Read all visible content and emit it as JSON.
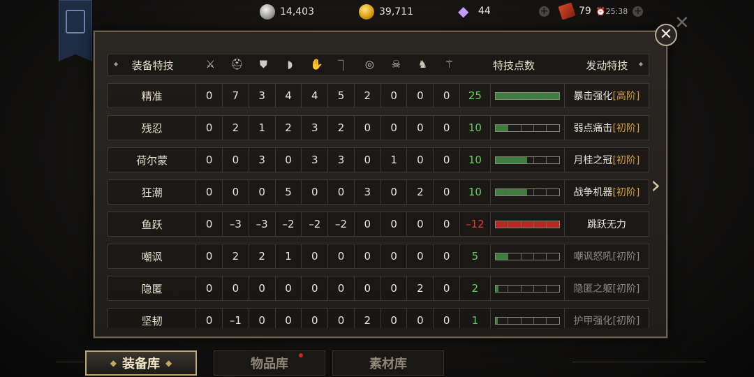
{
  "resources": {
    "silver": "14,403",
    "gold": "39,711",
    "gems": "44",
    "tickets": "79",
    "timer": "25:38"
  },
  "icons": {
    "silver": "silver-coin-icon",
    "gold": "gold-coin-icon",
    "gem": "diamond-icon",
    "ticket": "ticket-icon"
  },
  "header": {
    "equip_skill": "装备特技",
    "points": "特技点数",
    "active_skill": "发动特技",
    "slot_icons": [
      "sword-icon",
      "helmet-icon",
      "chest-armor-icon",
      "shoulder-icon",
      "gauntlet-icon",
      "boot-icon",
      "ring-icon",
      "demon-mask-icon",
      "horse-icon",
      "scythe-icon"
    ]
  },
  "rows": [
    {
      "name": "精准",
      "values": [
        "0",
        "7",
        "3",
        "4",
        "4",
        "5",
        "2",
        "0",
        "0",
        "0"
      ],
      "points": "25",
      "level": 1.0,
      "sign": "pos",
      "skill": "暴击强化",
      "tier": "[高阶]",
      "active": true
    },
    {
      "name": "残忍",
      "values": [
        "0",
        "2",
        "1",
        "2",
        "3",
        "2",
        "0",
        "0",
        "0",
        "0"
      ],
      "points": "10",
      "level": 0.2,
      "sign": "pos",
      "skill": "弱点痛击",
      "tier": "[初阶]",
      "active": true
    },
    {
      "name": "荷尔蒙",
      "values": [
        "0",
        "0",
        "3",
        "0",
        "3",
        "3",
        "0",
        "1",
        "0",
        "0"
      ],
      "points": "10",
      "level": 0.5,
      "sign": "pos",
      "skill": "月桂之冠",
      "tier": "[初阶]",
      "active": true
    },
    {
      "name": "狂潮",
      "values": [
        "0",
        "0",
        "0",
        "5",
        "0",
        "0",
        "3",
        "0",
        "2",
        "0"
      ],
      "points": "10",
      "level": 0.5,
      "sign": "pos",
      "skill": "战争机器",
      "tier": "[初阶]",
      "active": true
    },
    {
      "name": "鱼跃",
      "values": [
        "0",
        "–3",
        "–3",
        "–2",
        "–2",
        "–2",
        "0",
        "0",
        "0",
        "0"
      ],
      "points": "–12",
      "level": 1.0,
      "sign": "neg",
      "skill": "跳跃无力",
      "tier": "",
      "active": true
    },
    {
      "name": "嘲讽",
      "values": [
        "0",
        "2",
        "2",
        "1",
        "0",
        "0",
        "0",
        "0",
        "0",
        "0"
      ],
      "points": "5",
      "level": 0.2,
      "sign": "pos",
      "skill": "嘲讽怒吼",
      "tier": "[初阶]",
      "active": false
    },
    {
      "name": "隐匿",
      "values": [
        "0",
        "0",
        "0",
        "0",
        "0",
        "0",
        "0",
        "0",
        "2",
        "0"
      ],
      "points": "2",
      "level": 0.05,
      "sign": "pos",
      "skill": "隐匿之躯",
      "tier": "[初阶]",
      "active": false
    },
    {
      "name": "坚韧",
      "values": [
        "0",
        "–1",
        "0",
        "0",
        "0",
        "0",
        "2",
        "0",
        "0",
        "0"
      ],
      "points": "1",
      "level": 0.03,
      "sign": "pos",
      "skill": "护甲强化",
      "tier": "[初阶]",
      "active": false
    }
  ],
  "tabs": [
    {
      "label": "装备库",
      "active": true
    },
    {
      "label": "物品库",
      "active": false
    },
    {
      "label": "素材库",
      "active": false
    }
  ]
}
